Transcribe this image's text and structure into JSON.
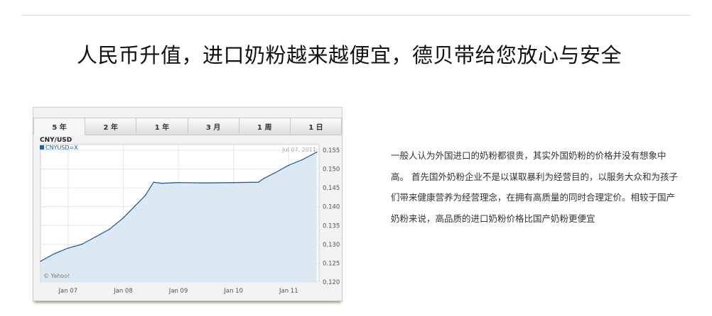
{
  "headline": "人民币升值，进口奶粉越来越便宜，德贝带给您放心与安全",
  "chart": {
    "tabs": [
      {
        "label": "5 年",
        "active": true
      },
      {
        "label": "2 年",
        "active": false
      },
      {
        "label": "1 年",
        "active": false
      },
      {
        "label": "3 月",
        "active": false
      },
      {
        "label": "1 周",
        "active": false
      },
      {
        "label": "1 日",
        "active": false
      }
    ],
    "title": "CNY/USD",
    "legend": "CNYUSD=X",
    "date_label": "Jul 07, 2011",
    "watermark": "© Yahoo!",
    "colors": {
      "line": "#2060a8",
      "fill": "#dce9f3",
      "legend_square": "#1d5fa8",
      "plot_bg": "#ffffff"
    }
  },
  "chart_data": {
    "type": "area",
    "title": "CNY/USD",
    "series": [
      {
        "name": "CNYUSD=X",
        "x": [
          2006.5,
          2006.75,
          2007.0,
          2007.25,
          2007.5,
          2007.75,
          2008.0,
          2008.2,
          2008.4,
          2008.55,
          2008.7,
          2009.0,
          2009.5,
          2010.0,
          2010.45,
          2010.55,
          2010.75,
          2011.0,
          2011.25,
          2011.51
        ],
        "y": [
          0.1255,
          0.1275,
          0.129,
          0.13,
          0.132,
          0.134,
          0.137,
          0.14,
          0.143,
          0.1465,
          0.1462,
          0.1464,
          0.1463,
          0.1464,
          0.1465,
          0.1475,
          0.149,
          0.151,
          0.1525,
          0.1545
        ]
      }
    ],
    "x_ticks": [
      "Jan 07",
      "Jan 08",
      "Jan 09",
      "Jan 10",
      "Jan 11"
    ],
    "x_tick_values": [
      2007.0,
      2008.0,
      2009.0,
      2010.0,
      2011.0
    ],
    "y_ticks": [
      "0.155",
      "0.150",
      "0.145",
      "0.140",
      "0.135",
      "0.130",
      "0.125",
      "0.120"
    ],
    "y_tick_values": [
      0.155,
      0.15,
      0.145,
      0.14,
      0.135,
      0.13,
      0.125,
      0.12
    ],
    "xlim": [
      2006.5,
      2011.55
    ],
    "ylim": [
      0.12,
      0.1565
    ],
    "grid": true,
    "legend_position": "top-left"
  },
  "body_text": "一般人认为外国进口的奶粉都很贵，其实外国奶粉的价格并没有想象中高。 首先国外奶粉企业不是以谋取暴利为经营目的，以服务大众和为孩子们带来健康营养为经营理念，在拥有高质量的同时合理定价。相较于国产奶粉来说，高品质的进口奶粉价格比国产奶粉更便宜"
}
